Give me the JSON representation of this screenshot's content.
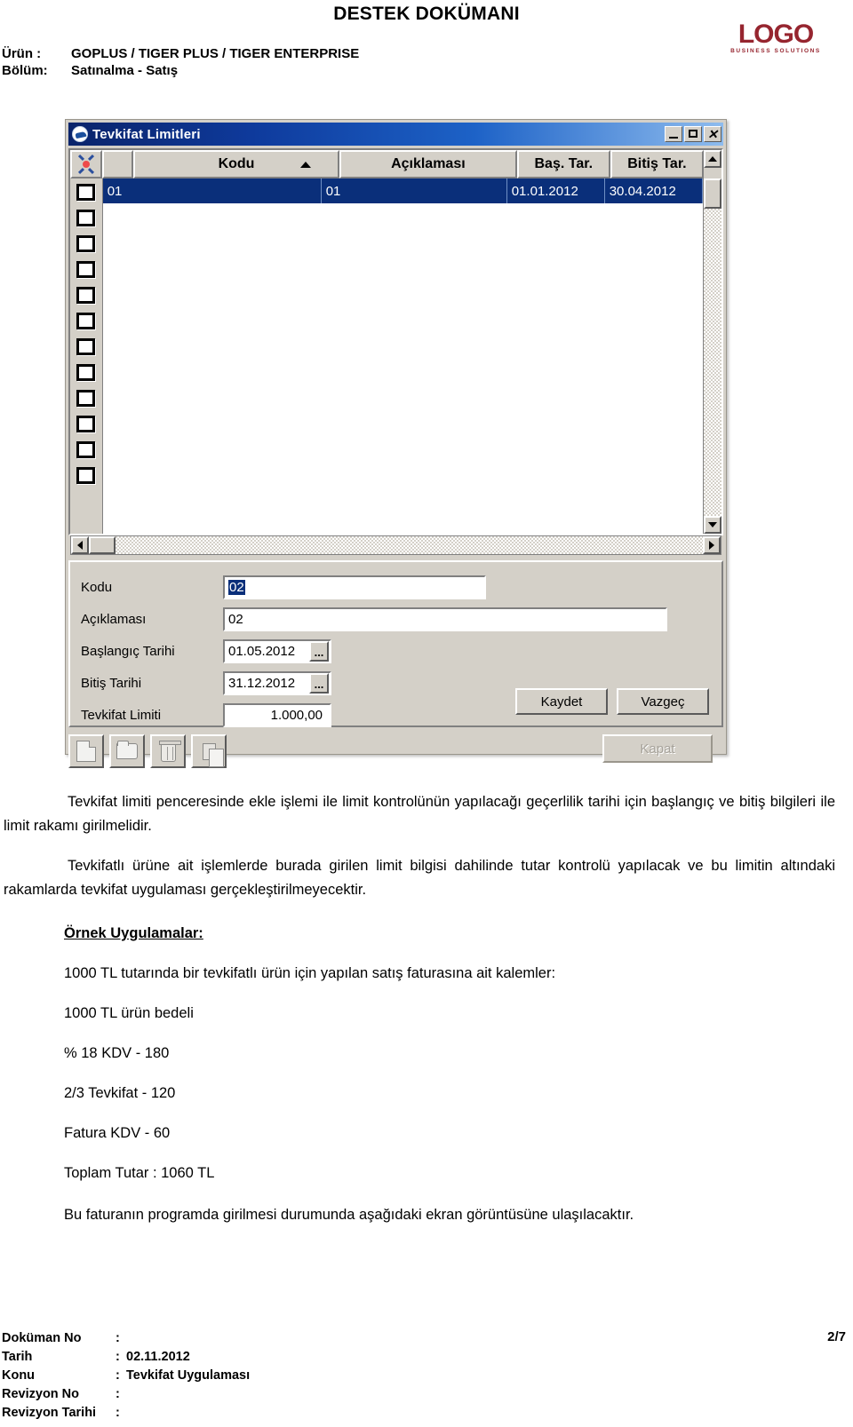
{
  "header": {
    "doc_title": "DESTEK DOKÜMANI",
    "logo_word": "LOGO",
    "logo_sub": "BUSINESS SOLUTIONS",
    "meta": [
      {
        "key": "Ürün :",
        "value": "GOPLUS / TIGER PLUS / TIGER ENTERPRISE"
      },
      {
        "key": "Bölüm:",
        "value": "Satınalma - Satış"
      }
    ]
  },
  "window": {
    "title": "Tevkifat Limitleri",
    "icon": "globe-icon",
    "buttons": {
      "minimize": "_",
      "maximize": "□",
      "close": "✕"
    },
    "grid": {
      "columns": [
        {
          "label": "Kodu",
          "sorted": "asc"
        },
        {
          "label": "Açıklaması"
        },
        {
          "label": "Baş. Tar."
        },
        {
          "label": "Bitiş Tar."
        }
      ],
      "rows": [
        {
          "kodu": "01",
          "aciklamasi": "01",
          "bas_tar": "01.01.2012",
          "bitis_tar": "30.04.2012",
          "selected": true
        }
      ],
      "empty_checkbox_count": 11
    },
    "form": {
      "fields": [
        {
          "label": "Kodu",
          "value": "02",
          "selected": true
        },
        {
          "label": "Açıklaması",
          "value": "02"
        },
        {
          "label": "Başlangıç Tarihi",
          "value": "01.05.2012",
          "picker": "..."
        },
        {
          "label": "Bitiş Tarihi",
          "value": "31.12.2012",
          "picker": "..."
        },
        {
          "label": "Tevkifat Limiti",
          "value": "1.000,00"
        }
      ],
      "save_label": "Kaydet",
      "cancel_label": "Vazgeç"
    },
    "toolbar": {
      "icons": [
        "new-document-icon",
        "open-folder-icon",
        "delete-trash-icon",
        "copy-icon"
      ],
      "close_label": "Kapat",
      "close_disabled": true
    }
  },
  "body": {
    "paragraph1": "Tevkifat limiti penceresinde ekle işlemi ile limit kontrolünün yapılacağı geçerlilik tarihi için başlangıç ve bitiş bilgileri ile limit rakamı girilmelidir.",
    "paragraph2": "Tevkifatlı ürüne ait işlemlerde burada girilen limit bilgisi dahilinde tutar kontrolü yapılacak ve bu limitin altındaki rakamlarda tevkifat uygulaması gerçekleştirilmeyecektir.",
    "section_title": "Örnek Uygulamalar:",
    "example_lines": [
      "1000 TL tutarında bir tevkifatlı ürün için yapılan satış faturasına ait kalemler:",
      "1000 TL ürün bedeli",
      "% 18 KDV  -  180",
      "2/3 Tevkifat  - 120",
      "Fatura KDV   - 60",
      "Toplam Tutar : 1060 TL"
    ],
    "closing": "Bu faturanın programda girilmesi durumunda aşağıdaki ekran görüntüsüne ulaşılacaktır."
  },
  "footer": {
    "rows": [
      {
        "key": "Doküman No",
        "colon": ":",
        "value": ""
      },
      {
        "key": "Tarih",
        "colon": ":",
        "value": "02.11.2012"
      },
      {
        "key": "Konu",
        "colon": ":",
        "value": "Tevkifat Uygulaması"
      },
      {
        "key": "Revizyon No",
        "colon": ":",
        "value": ""
      },
      {
        "key": "Revizyon Tarihi",
        "colon": ":",
        "value": ""
      }
    ],
    "page": "2/7"
  },
  "colors": {
    "brand_red": "#96252f",
    "titlebar_blue": "#0a246a",
    "selection_blue": "#0a2f7a",
    "window_face": "#d4d0c8"
  }
}
